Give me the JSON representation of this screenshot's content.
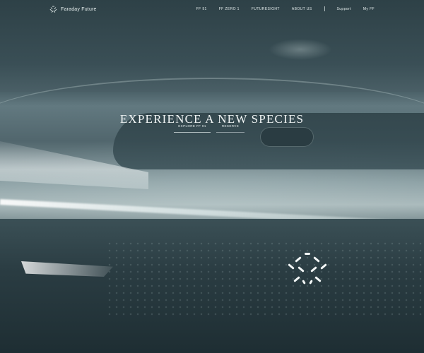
{
  "nav": {
    "brand": "Faraday Future",
    "items": [
      {
        "label": "FF 91"
      },
      {
        "label": "FF ZERO 1"
      },
      {
        "label": "FUTURESIGHT"
      },
      {
        "label": "ABOUT US"
      }
    ],
    "secondary": [
      {
        "label": "Support"
      },
      {
        "label": "My FF"
      }
    ]
  },
  "hero": {
    "headline": "EXPERIENCE A NEW SPECIES",
    "cta_primary": "EXPLORE FF 91",
    "cta_secondary": "RESERVE"
  },
  "icons": {
    "brand_logo": "ff-logo-icon",
    "car_emblem": "ff-emblem-icon"
  },
  "colors": {
    "text": "#e6eeee",
    "background": "#2c3f45"
  }
}
